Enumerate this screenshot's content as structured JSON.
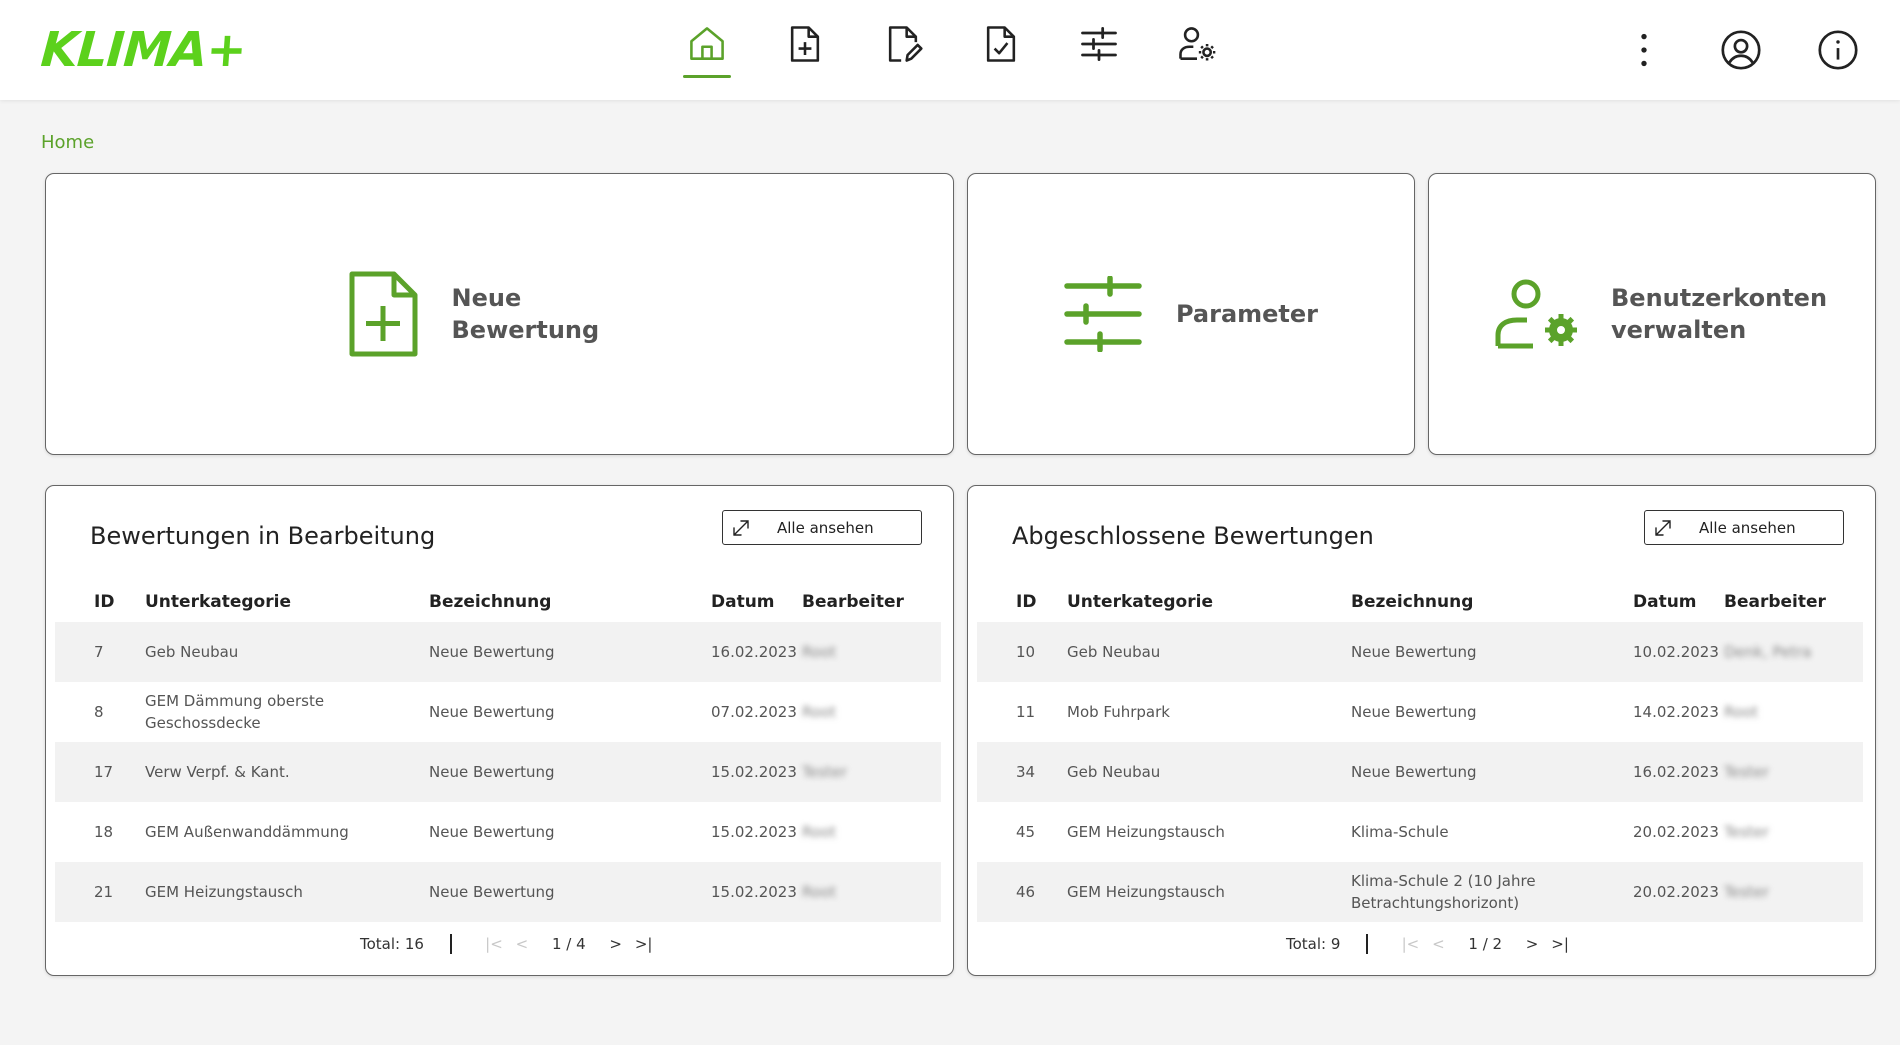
{
  "app": {
    "logo": "KLIMA+"
  },
  "nav": [
    {
      "icon": "home-icon",
      "active": true
    },
    {
      "icon": "file-plus-icon"
    },
    {
      "icon": "file-edit-icon"
    },
    {
      "icon": "file-check-icon"
    },
    {
      "icon": "sliders-icon"
    },
    {
      "icon": "user-gear-icon"
    }
  ],
  "header_actions": [
    "more-vertical-icon",
    "account-icon",
    "info-icon"
  ],
  "breadcrumb": "Home",
  "cards": {
    "new_rating": "Neue Bewertung",
    "parameters": "Parameter",
    "accounts": "Benutzerkonten verwalten"
  },
  "tables": {
    "in_progress": {
      "title": "Bewertungen in Bearbeitung",
      "button": "Alle ansehen",
      "headers": [
        "ID",
        "Unterkategorie",
        "Bezeichnung",
        "Datum",
        "Bearbeiter"
      ],
      "rows": [
        {
          "id": "7",
          "unterkategorie": "Geb Neubau",
          "bezeichnung": "Neue Bewertung",
          "datum": "16.02.2023",
          "bearbeiter": "Root"
        },
        {
          "id": "8",
          "unterkategorie": "GEM Dämmung oberste Geschossdecke",
          "bezeichnung": "Neue Bewertung",
          "datum": "07.02.2023",
          "bearbeiter": "Root"
        },
        {
          "id": "17",
          "unterkategorie": "Verw Verpf. & Kant.",
          "bezeichnung": "Neue Bewertung",
          "datum": "15.02.2023",
          "bearbeiter": "Tester"
        },
        {
          "id": "18",
          "unterkategorie": "GEM Außenwanddämmung",
          "bezeichnung": "Neue Bewertung",
          "datum": "15.02.2023",
          "bearbeiter": "Root"
        },
        {
          "id": "21",
          "unterkategorie": "GEM Heizungstausch",
          "bezeichnung": "Neue Bewertung",
          "datum": "15.02.2023",
          "bearbeiter": "Root"
        }
      ],
      "total": "Total: 16",
      "page": "1 / 4"
    },
    "completed": {
      "title": "Abgeschlossene Bewertungen",
      "button": "Alle ansehen",
      "headers": [
        "ID",
        "Unterkategorie",
        "Bezeichnung",
        "Datum",
        "Bearbeiter"
      ],
      "rows": [
        {
          "id": "10",
          "unterkategorie": "Geb Neubau",
          "bezeichnung": "Neue Bewertung",
          "datum": "10.02.2023",
          "bearbeiter": "Denk, Petra"
        },
        {
          "id": "11",
          "unterkategorie": "Mob Fuhrpark",
          "bezeichnung": "Neue Bewertung",
          "datum": "14.02.2023",
          "bearbeiter": "Root"
        },
        {
          "id": "34",
          "unterkategorie": "Geb Neubau",
          "bezeichnung": "Neue Bewertung",
          "datum": "16.02.2023",
          "bearbeiter": "Tester"
        },
        {
          "id": "45",
          "unterkategorie": "GEM Heizungstausch",
          "bezeichnung": "Klima-Schule",
          "datum": "20.02.2023",
          "bearbeiter": "Tester"
        },
        {
          "id": "46",
          "unterkategorie": "GEM Heizungstausch",
          "bezeichnung": "Klima-Schule 2 (10 Jahre Betrachtungshorizont)",
          "datum": "20.02.2023",
          "bearbeiter": "Tester"
        }
      ],
      "total": "Total: 9",
      "page": "1 / 2"
    }
  },
  "colors": {
    "accent": "#5ba22a",
    "logo": "#5cd11c"
  }
}
